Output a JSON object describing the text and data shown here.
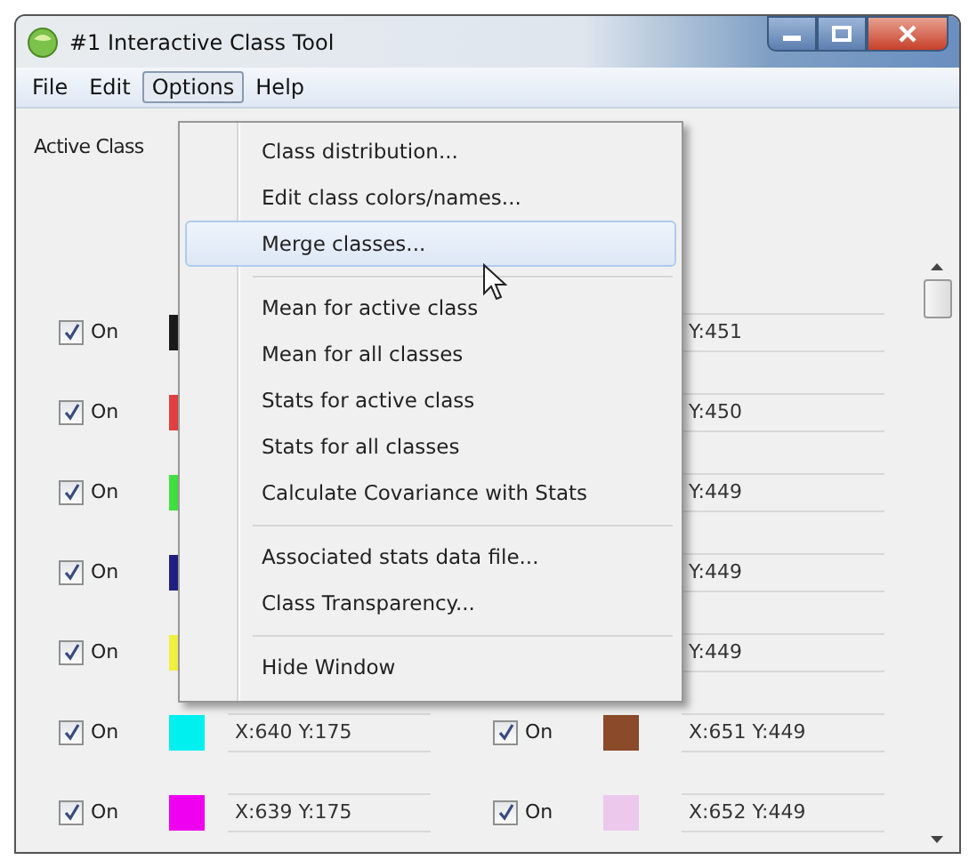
{
  "window": {
    "title": "#1 Interactive Class Tool"
  },
  "menubar": [
    {
      "label": "File",
      "selected": false
    },
    {
      "label": "Edit",
      "selected": false
    },
    {
      "label": "Options",
      "selected": true
    },
    {
      "label": "Help",
      "selected": false
    }
  ],
  "active_class_label": "Active Class",
  "rows": [
    {
      "left": {
        "label": "On",
        "checked": true,
        "color": "#1a1a1a"
      },
      "right": {
        "coords": "Y:451"
      }
    },
    {
      "left": {
        "label": "On",
        "checked": true,
        "color": "#e04040"
      },
      "right": {
        "coords": "Y:450"
      }
    },
    {
      "left": {
        "label": "On",
        "checked": true,
        "color": "#40e040"
      },
      "right": {
        "coords": "Y:449"
      }
    },
    {
      "left": {
        "label": "On",
        "checked": true,
        "color": "#202080"
      },
      "right": {
        "coords": "Y:449"
      }
    },
    {
      "left": {
        "label": "On",
        "checked": true,
        "color": "#f0f040"
      },
      "right": {
        "coords": "Y:449"
      }
    },
    {
      "left": {
        "label": "On",
        "checked": true,
        "color": "#00f0f0",
        "coords": "X:640 Y:175"
      },
      "right": {
        "label": "On",
        "checked": true,
        "color": "#8b4a2a",
        "coords": "X:651 Y:449"
      }
    },
    {
      "left": {
        "label": "On",
        "checked": true,
        "color": "#f000f0",
        "coords": "X:639 Y:175"
      },
      "right": {
        "label": "On",
        "checked": true,
        "color": "#ecc8ec",
        "coords": "X:652 Y:449"
      }
    }
  ],
  "menu": [
    {
      "kind": "item",
      "label": "Class distribution...",
      "highlighted": false
    },
    {
      "kind": "item",
      "label": "Edit class colors/names...",
      "highlighted": false
    },
    {
      "kind": "item",
      "label": "Merge classes...",
      "highlighted": true
    },
    {
      "kind": "separator"
    },
    {
      "kind": "item",
      "label": "Mean for active class",
      "highlighted": false
    },
    {
      "kind": "item",
      "label": "Mean for all classes",
      "highlighted": false
    },
    {
      "kind": "item",
      "label": "Stats for active class",
      "highlighted": false
    },
    {
      "kind": "item",
      "label": "Stats for all classes",
      "highlighted": false
    },
    {
      "kind": "item",
      "label": "Calculate Covariance with Stats",
      "highlighted": false
    },
    {
      "kind": "separator"
    },
    {
      "kind": "item",
      "label": "Associated stats data file...",
      "highlighted": false
    },
    {
      "kind": "item",
      "label": "Class Transparency...",
      "highlighted": false
    },
    {
      "kind": "separator"
    },
    {
      "kind": "item",
      "label": "Hide Window",
      "highlighted": false
    }
  ]
}
